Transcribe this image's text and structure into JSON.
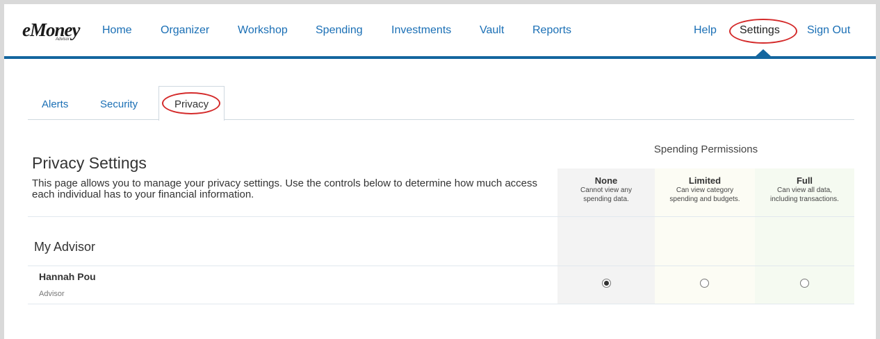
{
  "logo": {
    "name": "eMoney",
    "sub": "Advisor"
  },
  "nav": {
    "home": "Home",
    "organizer": "Organizer",
    "workshop": "Workshop",
    "spending": "Spending",
    "investments": "Investments",
    "vault": "Vault",
    "reports": "Reports",
    "help": "Help",
    "settings": "Settings",
    "sign_out": "Sign Out"
  },
  "tabs": {
    "alerts": "Alerts",
    "security": "Security",
    "privacy": "Privacy"
  },
  "page": {
    "title": "Privacy Settings",
    "description": "This page allows you to manage your privacy settings.  Use the controls below to determine how much access each individual has to your financial information."
  },
  "permissions": {
    "title": "Spending Permissions",
    "columns": [
      {
        "label": "None",
        "desc1": "Cannot view any",
        "desc2": "spending data."
      },
      {
        "label": "Limited",
        "desc1": "Can view category",
        "desc2": "spending and budgets."
      },
      {
        "label": "Full",
        "desc1": "Can view all data,",
        "desc2": "including transactions."
      }
    ]
  },
  "group": {
    "label": "My Advisor",
    "people": [
      {
        "name": "Hannah Pou",
        "role": "Advisor",
        "selected": "None"
      }
    ]
  },
  "colors": {
    "accent": "#14669f",
    "link": "#1a6fb5",
    "highlight_circle": "#d42a2a"
  }
}
